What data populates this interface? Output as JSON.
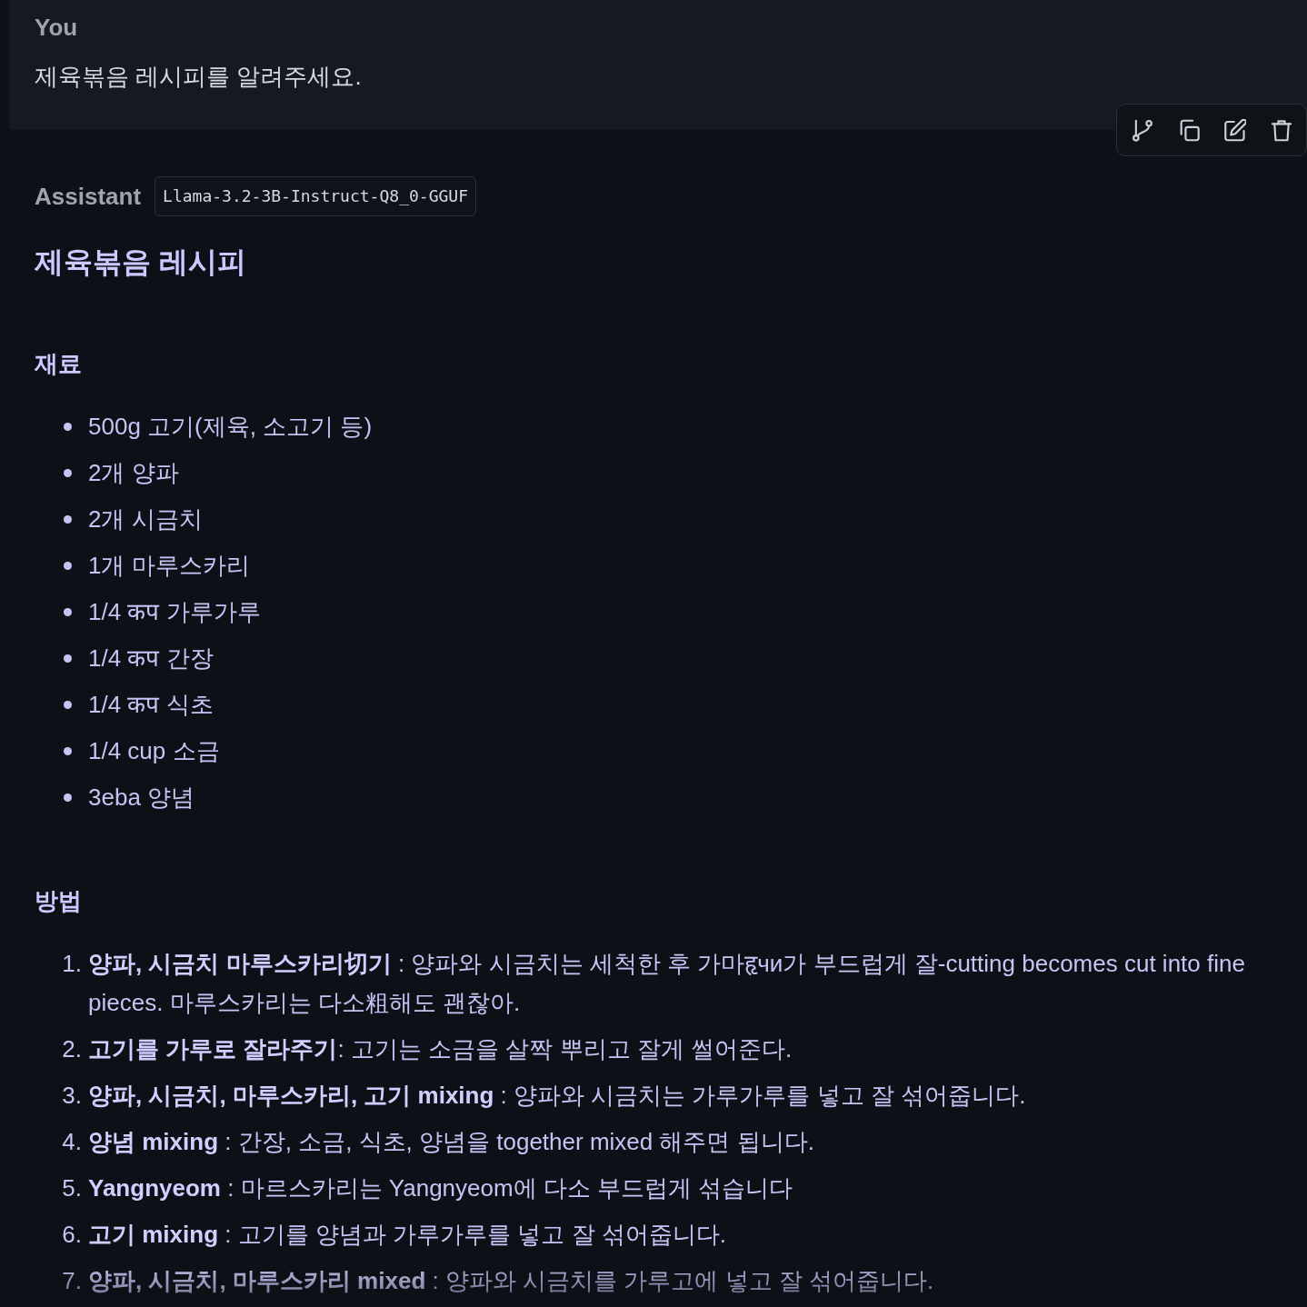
{
  "user_message": {
    "author": "You",
    "text": "제육볶음 레시피를 알려주세요."
  },
  "assistant_message": {
    "author": "Assistant",
    "model": "Llama-3.2-3B-Instruct-Q8_0-GGUF",
    "title": "제육볶음 레시피",
    "sections": [
      {
        "heading": "재료",
        "kind": "bulleted",
        "items": [
          "500g 고기(제육, 소고기 등)",
          "2개 양파",
          "2개 시금치",
          "1개 마루스카리",
          "1/4 कप 가루가루",
          "1/4 कप 간장",
          "1/4 कप 식초",
          "1/4 cup 소금",
          "3eba 양념"
        ]
      },
      {
        "heading": "방법",
        "kind": "numbered",
        "items": [
          {
            "number": "1.",
            "text": "**양파, 시금치 마루스카리切기** : 양파와 시금치는 세척한 후 가마हृчи가 부드럽게 잘-cutting becomes cut into fine pieces. 마루스카리는 다소粗해도 괜찮아."
          },
          {
            "number": "2.",
            "text": "**고기를 가루로 잘라주기**: 고기는 소금을 살짝 뿌리고 잘게 썰어준다."
          },
          {
            "number": "3.",
            "text": "**양파, 시금치, 마루스카리, 고기 mixing** : 양파와 시금치는 가루가루를 넣고 잘 섞어줍니다."
          },
          {
            "number": "4.",
            "text": "**양념 mixing** : 간장, 소금, 식초, 양념을 together mixed 해주면 됩니다."
          },
          {
            "number": "5.",
            "text": "**Yangnyeom** : 마르스카리는 Yangnyeom에 다소 부드럽게 섞습니다"
          },
          {
            "number": "6.",
            "text": "**고기 mixing** : 고기를 양념과 가루가루를 넣고 잘 섞어줍니다."
          },
          {
            "number": "7.",
            "text": "**양파, 시금치, 마루스카리 mixed** : 양파와 시금치를 가루고에 넣고 잘 섞어줍니다."
          }
        ]
      }
    ]
  }
}
